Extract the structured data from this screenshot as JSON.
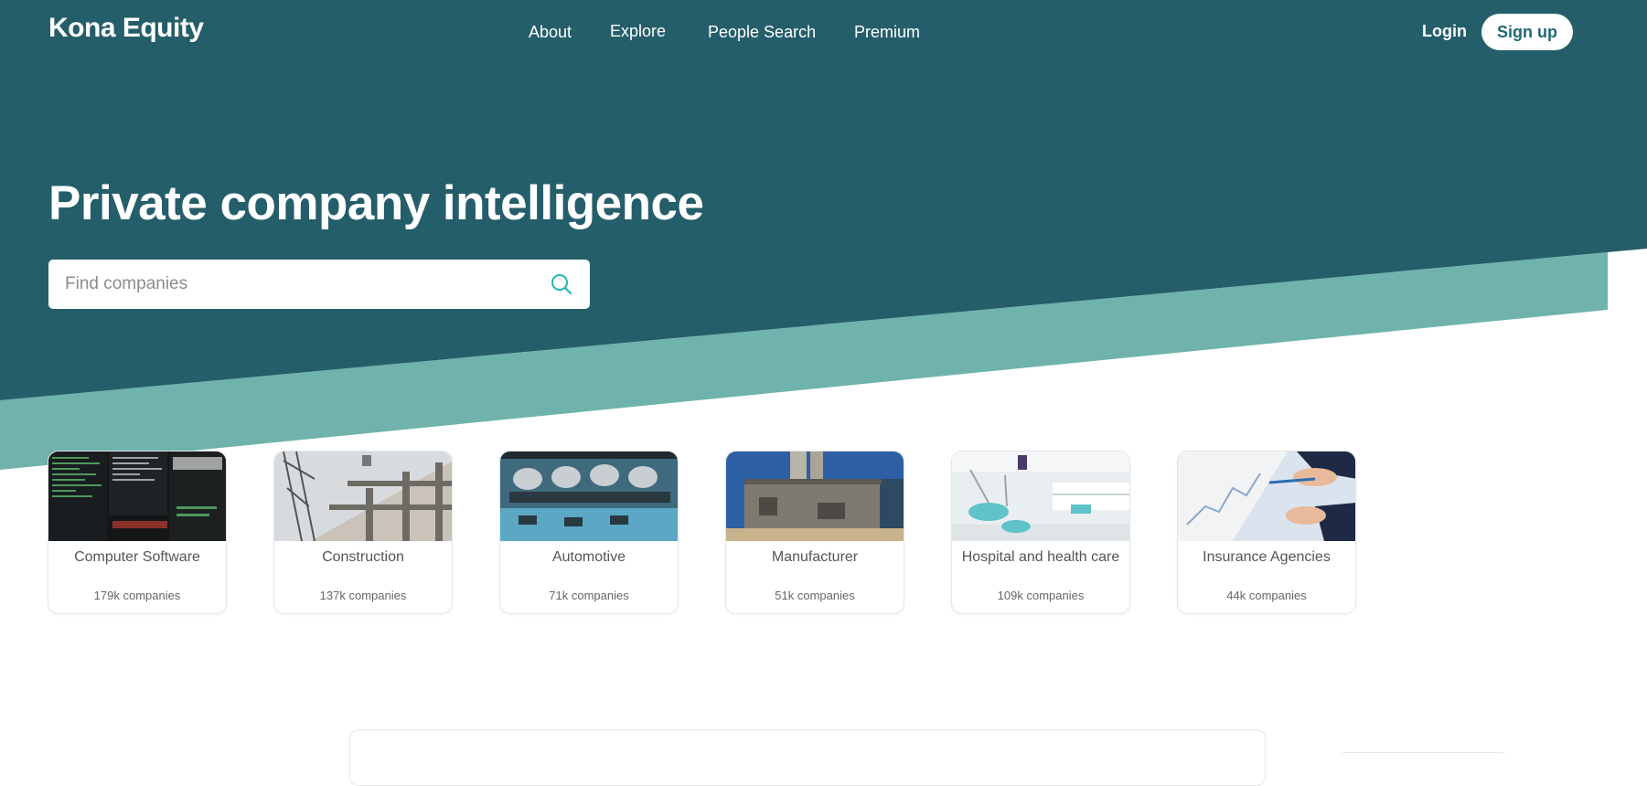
{
  "colors": {
    "hero_dark": "#245e6a",
    "hero_stripe": "#6fb3ac",
    "accent": "#1fb8b0",
    "brand_text": "#1f6772"
  },
  "nav": {
    "logo": "Kona Equity",
    "links": [
      "About",
      "Explore",
      "People Search",
      "Premium"
    ],
    "login": "Login",
    "signup": "Sign up"
  },
  "hero": {
    "title": "Private company intelligence",
    "search": {
      "placeholder": "Find companies",
      "value": "",
      "icon": "search-icon"
    }
  },
  "industries": [
    {
      "name": "Computer Software",
      "count": "179k companies",
      "image": "terminal-screens"
    },
    {
      "name": "Construction",
      "count": "137k companies",
      "image": "building-crane"
    },
    {
      "name": "Automotive",
      "count": "71k companies",
      "image": "engine-block"
    },
    {
      "name": "Manufacturer",
      "count": "51k companies",
      "image": "industrial-plant"
    },
    {
      "name": "Hospital and health care",
      "count": "109k companies",
      "image": "dental-clinic"
    },
    {
      "name": "Insurance Agencies",
      "count": "44k companies",
      "image": "hands-with-chart"
    }
  ]
}
